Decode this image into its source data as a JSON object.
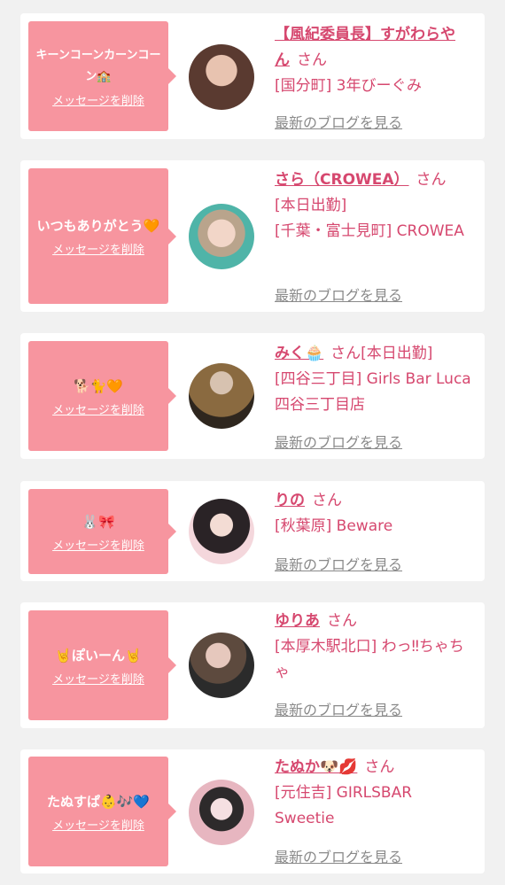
{
  "cards": [
    {
      "message": "キーンコーンカーンコーン🏫",
      "delete_label": "メッセージを削除",
      "name": "【風紀委員長】すがわらやん",
      "honorific": "さん",
      "status": "",
      "shop": "[国分町] 3年びーぐみ",
      "blog_label": "最新のブログを見る"
    },
    {
      "message": "いつもありがとう🧡",
      "delete_label": "メッセージを削除",
      "name": "さら（CROWEA）",
      "honorific": "さん",
      "status": "[本日出勤]",
      "shop": "[千葉・富士見町] CROWEA",
      "blog_label": "最新のブログを見る"
    },
    {
      "message": "🐕🐈🧡",
      "delete_label": "メッセージを削除",
      "name": "みく🧁",
      "honorific": "さん",
      "status": "[本日出勤]",
      "shop": "[四谷三丁目] Girls Bar Luca 四谷三丁目店",
      "blog_label": "最新のブログを見る"
    },
    {
      "message": "🐰🎀",
      "delete_label": "メッセージを削除",
      "name": "りの",
      "honorific": "さん",
      "status": "",
      "shop": "[秋葉原] Beware",
      "blog_label": "最新のブログを見る"
    },
    {
      "message": "🤘ぽいーん🤘",
      "delete_label": "メッセージを削除",
      "name": "ゆりあ",
      "honorific": "さん",
      "status": "",
      "shop": "[本厚木駅北口] わっ‼ちゃちゃ",
      "blog_label": "最新のブログを見る"
    },
    {
      "message": "たぬすぱ👶🎶💙",
      "delete_label": "メッセージを削除",
      "name": "たぬか🐶💋",
      "honorific": "さん",
      "status": "",
      "shop": "[元住吉] GIRLSBAR Sweetie",
      "blog_label": "最新のブログを見る"
    }
  ],
  "colors": {
    "background": "#f1f1f1",
    "card": "#ffffff",
    "bubble": "#f7959f",
    "accent_text": "#d6486f",
    "link_gray": "#8a8a8a"
  }
}
